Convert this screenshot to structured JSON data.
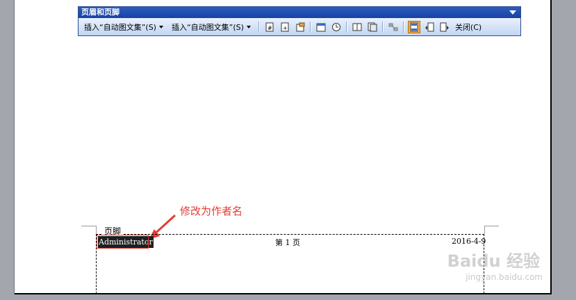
{
  "toolbar": {
    "title": "页眉和页脚",
    "autotext_menu_1": "插入“自动图文集”(S)",
    "autotext_menu_2": "插入“自动图文集”(S)",
    "close_label": "关闭(C)"
  },
  "footer": {
    "label": "页脚",
    "author": "Administrator",
    "page_text": "第 1 页",
    "date": "2016-4-9"
  },
  "annotation": {
    "text": "修改为作者名",
    "color": "#e53b34"
  },
  "watermark": {
    "text": "Baidu 经验",
    "url": "jingyan.baidu.com"
  }
}
